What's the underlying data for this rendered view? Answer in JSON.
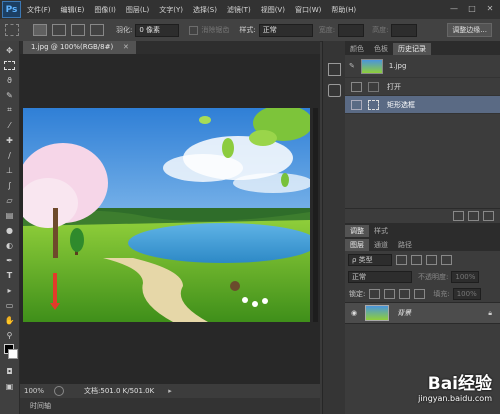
{
  "app": {
    "logo": "Ps"
  },
  "menu": [
    "文件(F)",
    "编辑(E)",
    "图像(I)",
    "图层(L)",
    "文字(Y)",
    "选择(S)",
    "滤镜(T)",
    "视图(V)",
    "窗口(W)",
    "帮助(H)"
  ],
  "window_controls": [
    "—",
    "□",
    "✕"
  ],
  "options": {
    "feather_label": "羽化:",
    "feather_value": "0 像素",
    "antialias_label": "消除锯齿",
    "style_label": "样式:",
    "style_value": "正常",
    "width_label": "宽度:",
    "height_label": "高度:",
    "adjust_edge": "调整边缘..."
  },
  "document": {
    "tab_title": "1.jpg @ 100%(RGB/8#)",
    "close": "✕"
  },
  "status": {
    "zoom": "100%",
    "doc_info": "文档:501.0 K/501.0K"
  },
  "timeline_tab": "时间轴",
  "history_panel": {
    "tabs": [
      "颜色",
      "色板",
      "历史记录"
    ],
    "active_tab": "历史记录",
    "snapshot": "1.jpg",
    "states": [
      "打开",
      "矩形选框"
    ],
    "selected_state": "矩形选框"
  },
  "adjust_panel": {
    "tabs": [
      "调整",
      "样式"
    ]
  },
  "layers_panel": {
    "tabs": [
      "图层",
      "通道",
      "路径"
    ],
    "active_tab": "图层",
    "filter_type": "ρ 类型",
    "blend_mode": "正常",
    "opacity_label": "不透明度:",
    "opacity_value": "100%",
    "lock_label": "锁定:",
    "fill_label": "填充:",
    "fill_value": "100%",
    "layers": [
      {
        "name": "背景",
        "visible": true,
        "locked": true
      }
    ]
  },
  "watermark": {
    "brand": "Bai经验",
    "url": "jingyan.baidu.com"
  },
  "colors": {
    "accent_blue": "#5a6a84",
    "ps_blue": "#5fb3ff"
  }
}
